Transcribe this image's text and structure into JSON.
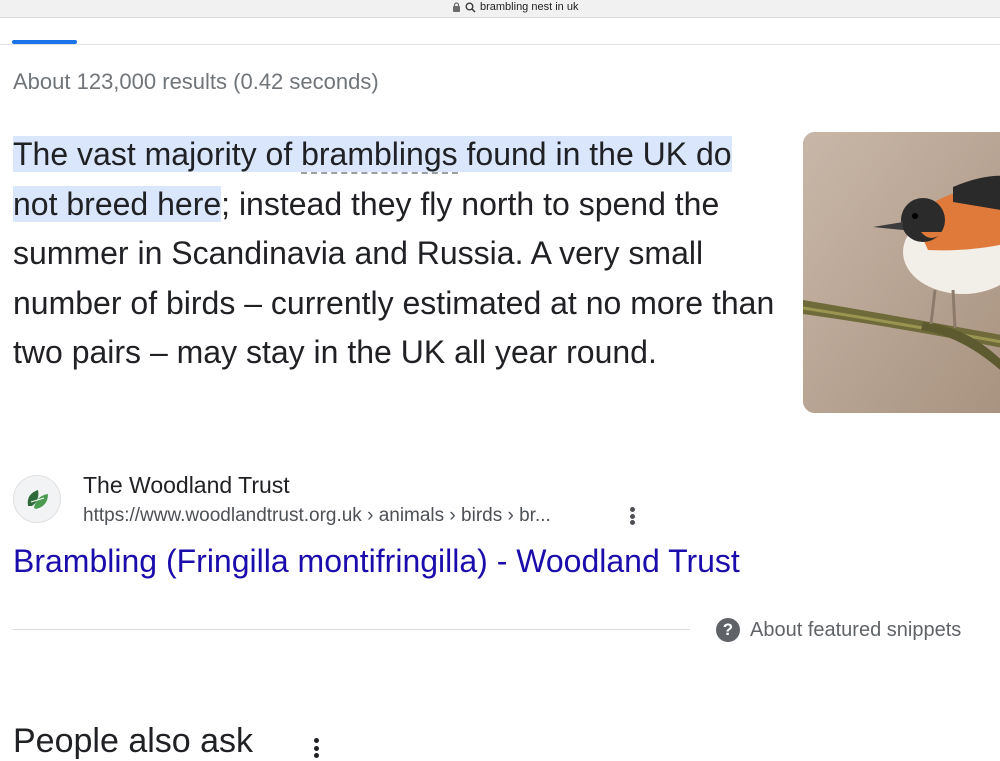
{
  "address_bar": {
    "query": "brambling nest in uk",
    "lock_icon": "lock-icon",
    "search_icon": "search-icon"
  },
  "results_stats": "About 123,000 results (0.42 seconds)",
  "featured_snippet": {
    "highlight_part1": "The vast majority of ",
    "highlight_word": "bramblings",
    "highlight_part2": " found in the UK do not breed here",
    "rest": "; instead they fly north to spend the summer in Scandinavia and Russia. A very small number of birds – currently estimated at no more than two pairs – may stay in the UK all year round."
  },
  "source": {
    "site_name": "The Woodland Trust",
    "url": "https://www.woodlandtrust.org.uk › animals › birds › br...",
    "favicon": "woodland-trust-leaf-icon"
  },
  "result_title": "Brambling (Fringilla montifringilla) - Woodland Trust",
  "about_snippets": "About featured snippets",
  "people_also_ask": "People also ask",
  "colors": {
    "link": "#1a0dab",
    "highlight": "#d9e6fc",
    "tab_indicator": "#1a73e8"
  }
}
